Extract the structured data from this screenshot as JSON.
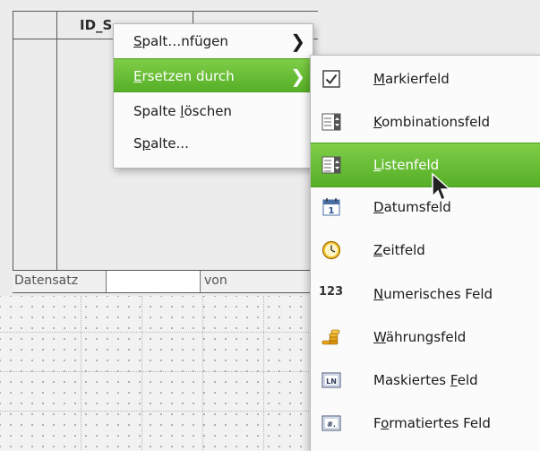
{
  "grid": {
    "column_title": "ID_S",
    "navigation": {
      "record_label": "Datensatz",
      "of_label": "von"
    }
  },
  "context_menu": {
    "items": [
      {
        "label_pre": "",
        "mnemonic": "S",
        "label_post": "palt…nfügen",
        "has_submenu": true,
        "highlighted": false
      },
      {
        "label_pre": "",
        "mnemonic": "E",
        "label_post": "rsetzen durch",
        "has_submenu": true,
        "highlighted": true
      },
      {
        "label_pre": "Spalte ",
        "mnemonic": "l",
        "label_post": "öschen",
        "has_submenu": false,
        "highlighted": false
      },
      {
        "label_pre": "S",
        "mnemonic": "p",
        "label_post": "alte...",
        "has_submenu": false,
        "highlighted": false
      }
    ]
  },
  "submenu": {
    "items": [
      {
        "icon": "checkbox-icon",
        "label_pre": "",
        "mnemonic": "M",
        "label_post": "arkierfeld",
        "highlighted": false
      },
      {
        "icon": "combobox-icon",
        "label_pre": "",
        "mnemonic": "K",
        "label_post": "ombinationsfeld",
        "highlighted": false
      },
      {
        "icon": "listbox-icon",
        "label_pre": "",
        "mnemonic": "L",
        "label_post": "istenfeld",
        "highlighted": true
      },
      {
        "icon": "calendar-icon",
        "label_pre": "",
        "mnemonic": "D",
        "label_post": "atumsfeld",
        "highlighted": false
      },
      {
        "icon": "clock-icon",
        "label_pre": "",
        "mnemonic": "Z",
        "label_post": "eitfeld",
        "highlighted": false
      },
      {
        "icon": "numeric-icon",
        "icon_text": "123",
        "label_pre": "",
        "mnemonic": "N",
        "label_post": "umerisches Feld",
        "highlighted": false
      },
      {
        "icon": "coins-icon",
        "label_pre": "",
        "mnemonic": "W",
        "label_post": "ährungsfeld",
        "highlighted": false
      },
      {
        "icon": "pattern-field-icon",
        "icon_text": "LN",
        "label_pre": "Maskiertes ",
        "mnemonic": "F",
        "label_post": "eld",
        "highlighted": false
      },
      {
        "icon": "formatted-field-icon",
        "icon_text": "#.",
        "label_pre": "F",
        "mnemonic": "o",
        "label_post": "rmatiertes Feld",
        "highlighted": false
      }
    ]
  },
  "colors": {
    "highlight": "#5fb82f",
    "menu_bg": "#fbfbfb"
  }
}
